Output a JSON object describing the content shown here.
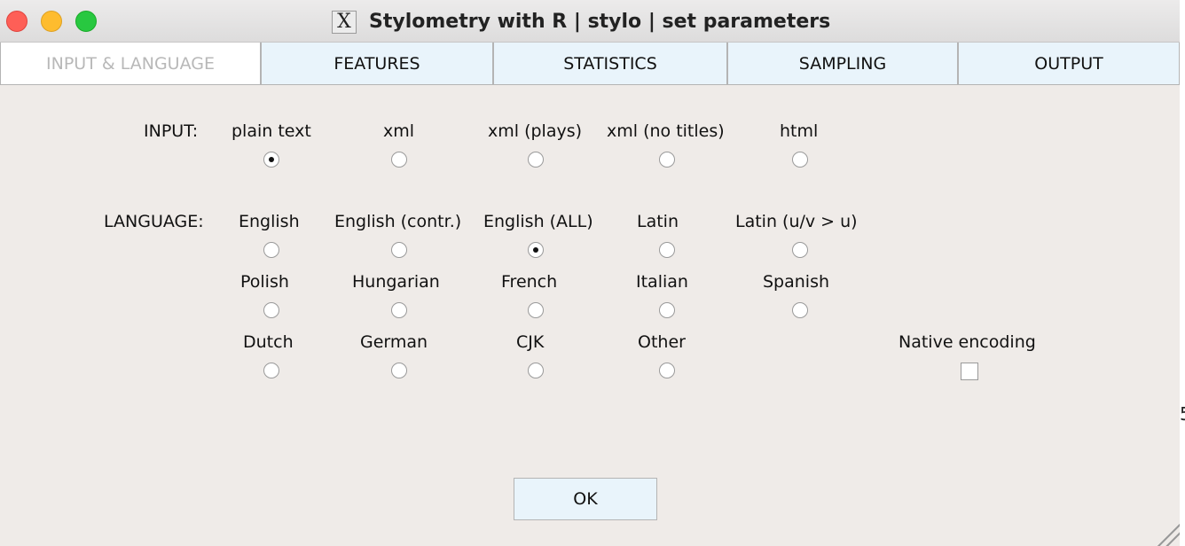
{
  "window": {
    "title": "Stylometry with R | stylo | set parameters",
    "title_icon": "X"
  },
  "tabs": [
    {
      "label": "INPUT & LANGUAGE",
      "active": true
    },
    {
      "label": "FEATURES",
      "active": false
    },
    {
      "label": "STATISTICS",
      "active": false
    },
    {
      "label": "SAMPLING",
      "active": false
    },
    {
      "label": "OUTPUT",
      "active": false
    }
  ],
  "input": {
    "label": "INPUT:",
    "selected": "plain text",
    "options": [
      "plain text",
      "xml",
      "xml (plays)",
      "xml (no titles)",
      "html"
    ]
  },
  "language": {
    "label": "LANGUAGE:",
    "selected": "English (ALL)",
    "options": [
      "English",
      "English (contr.)",
      "English (ALL)",
      "Latin",
      "Latin (u/v > u)",
      "Polish",
      "Hungarian",
      "French",
      "Italian",
      "Spanish",
      "Dutch",
      "German",
      "CJK",
      "Other"
    ]
  },
  "native_encoding": {
    "label": "Native encoding",
    "checked": false
  },
  "ok_button": {
    "label": "OK"
  },
  "offscreen_glyph": "5",
  "colors": {
    "panel_bg": "#efebe8",
    "tab_bg": "#e9f4fb",
    "close": "#fe5f57",
    "minimize": "#febc2e",
    "maximize": "#28c840"
  }
}
